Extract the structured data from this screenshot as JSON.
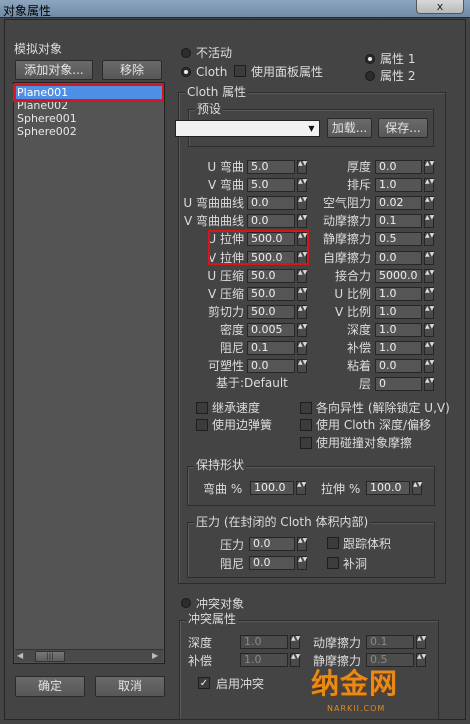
{
  "window": {
    "title": "对象属性",
    "close": "x"
  },
  "objects": {
    "label": "模拟对象",
    "add": "添加对象...",
    "remove": "移除",
    "items": [
      "Plane001",
      "Plane002",
      "Sphere001",
      "Sphere002"
    ],
    "selected": 0
  },
  "mode": {
    "inactive": "不活动",
    "cloth": "Cloth",
    "selected": "Cloth",
    "use_panel": "使用面板属性",
    "prop1": "属性 1",
    "prop2": "属性 2",
    "selected_prop": "属性 1"
  },
  "cloth": {
    "group": "Cloth 属性",
    "preset": {
      "label": "预设",
      "value": "",
      "load": "加载...",
      "save": "保存..."
    },
    "left_params": [
      {
        "label": "U 弯曲",
        "value": "5.0"
      },
      {
        "label": "V 弯曲",
        "value": "5.0"
      },
      {
        "label": "U 弯曲曲线",
        "value": "0.0"
      },
      {
        "label": "V 弯曲曲线",
        "value": "0.0"
      },
      {
        "label": "U 拉伸",
        "value": "500.0"
      },
      {
        "label": "V 拉伸",
        "value": "500.0"
      },
      {
        "label": "U 压缩",
        "value": "50.0"
      },
      {
        "label": "V 压缩",
        "value": "50.0"
      },
      {
        "label": "剪切力",
        "value": "50.0"
      },
      {
        "label": "密度",
        "value": "0.005"
      },
      {
        "label": "阻尼",
        "value": "0.1"
      },
      {
        "label": "可塑性",
        "value": "0.0"
      }
    ],
    "right_params": [
      {
        "label": "厚度",
        "value": "0.0"
      },
      {
        "label": "排斥",
        "value": "1.0"
      },
      {
        "label": "空气阻力",
        "value": "0.02"
      },
      {
        "label": "动摩擦力",
        "value": "0.1"
      },
      {
        "label": "静摩擦力",
        "value": "0.5"
      },
      {
        "label": "自摩擦力",
        "value": "0.0"
      },
      {
        "label": "接合力",
        "value": "5000.0"
      },
      {
        "label": "U 比例",
        "value": "1.0"
      },
      {
        "label": "V 比例",
        "value": "1.0"
      },
      {
        "label": "深度",
        "value": "1.0"
      },
      {
        "label": "补偿",
        "value": "1.0"
      },
      {
        "label": "粘着",
        "value": "0.0"
      },
      {
        "label": "层",
        "value": "0"
      }
    ],
    "based_on": "基于:Default",
    "checks": {
      "inherit_velocity": "继承速度",
      "use_edge_springs": "使用边弹簧",
      "anisotropic": "各向异性 (解除锁定 U,V)",
      "use_depth_offset": "使用 Cloth 深度/偏移",
      "use_collision_friction": "使用碰撞对象摩擦"
    },
    "shape": {
      "group": "保持形状",
      "bend_label": "弯曲 %",
      "bend": "100.0",
      "stretch_label": "拉伸 %",
      "stretch": "100.0"
    },
    "pressure": {
      "group": "压力 (在封闭的 Cloth 体积内部)",
      "pressure_label": "压力",
      "pressure": "0.0",
      "damping_label": "阻尼",
      "damping": "0.0",
      "track_volume": "跟踪体积",
      "cap_holes": "补洞"
    }
  },
  "collision": {
    "radio": "冲突对象",
    "group": "冲突属性",
    "depth_label": "深度",
    "depth": "1.0",
    "offset_label": "补偿",
    "offset": "1.0",
    "dyn_label": "动摩擦力",
    "dyn": "0.1",
    "static_label": "静摩擦力",
    "static": "0.5",
    "enable": "启用冲突"
  },
  "footer": {
    "ok": "确定",
    "cancel": "取消"
  },
  "watermark": {
    "brand": "纳金网",
    "url": "NARKII.COM"
  },
  "colors": {
    "selection": "#4e8fe6",
    "highlight_box": "#d6161c",
    "watermark": "#e88a18"
  }
}
